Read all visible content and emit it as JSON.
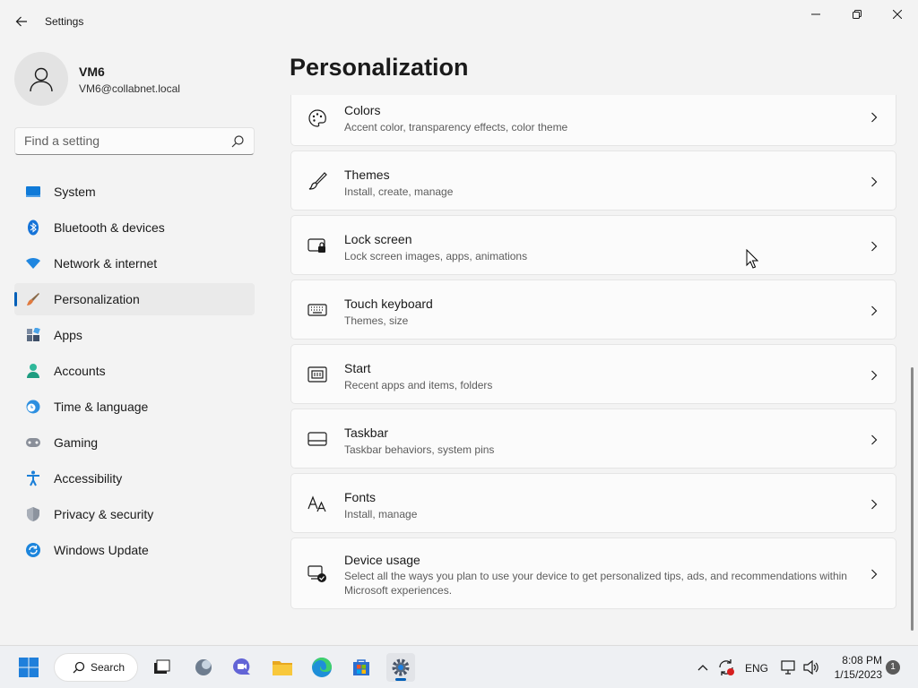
{
  "window": {
    "title": "Settings",
    "back_label": "Back",
    "minimize_label": "Minimize",
    "maximize_label": "Restore",
    "close_label": "Close"
  },
  "profile": {
    "name": "VM6",
    "email": "VM6@collabnet.local"
  },
  "search": {
    "placeholder": "Find a setting"
  },
  "sidebar": {
    "items": [
      {
        "label": "System",
        "icon": "system-icon"
      },
      {
        "label": "Bluetooth & devices",
        "icon": "bluetooth-icon"
      },
      {
        "label": "Network & internet",
        "icon": "network-icon"
      },
      {
        "label": "Personalization",
        "icon": "personalization-icon",
        "selected": true
      },
      {
        "label": "Apps",
        "icon": "apps-icon"
      },
      {
        "label": "Accounts",
        "icon": "accounts-icon"
      },
      {
        "label": "Time & language",
        "icon": "time-language-icon"
      },
      {
        "label": "Gaming",
        "icon": "gaming-icon"
      },
      {
        "label": "Accessibility",
        "icon": "accessibility-icon"
      },
      {
        "label": "Privacy & security",
        "icon": "privacy-shield-icon"
      },
      {
        "label": "Windows Update",
        "icon": "windows-update-icon"
      }
    ]
  },
  "main": {
    "title": "Personalization",
    "cards": [
      {
        "title": "Colors",
        "subtitle": "Accent color, transparency effects, color theme",
        "icon": "palette-icon"
      },
      {
        "title": "Themes",
        "subtitle": "Install, create, manage",
        "icon": "brush-icon"
      },
      {
        "title": "Lock screen",
        "subtitle": "Lock screen images, apps, animations",
        "icon": "lock-screen-icon"
      },
      {
        "title": "Touch keyboard",
        "subtitle": "Themes, size",
        "icon": "keyboard-icon"
      },
      {
        "title": "Start",
        "subtitle": "Recent apps and items, folders",
        "icon": "start-icon"
      },
      {
        "title": "Taskbar",
        "subtitle": "Taskbar behaviors, system pins",
        "icon": "taskbar-icon"
      },
      {
        "title": "Fonts",
        "subtitle": "Install, manage",
        "icon": "fonts-icon"
      },
      {
        "title": "Device usage",
        "subtitle": "Select all the ways you plan to use your device to get personalized tips, ads, and recommendations within Microsoft experiences.",
        "icon": "device-usage-icon"
      }
    ]
  },
  "taskbar": {
    "search_label": "Search",
    "language": "ENG",
    "time": "8:08 PM",
    "date": "1/15/2023",
    "notification_count": "1"
  },
  "colors": {
    "accent": "#005fb8",
    "background": "#f3f3f3",
    "card": "#fbfbfb"
  }
}
